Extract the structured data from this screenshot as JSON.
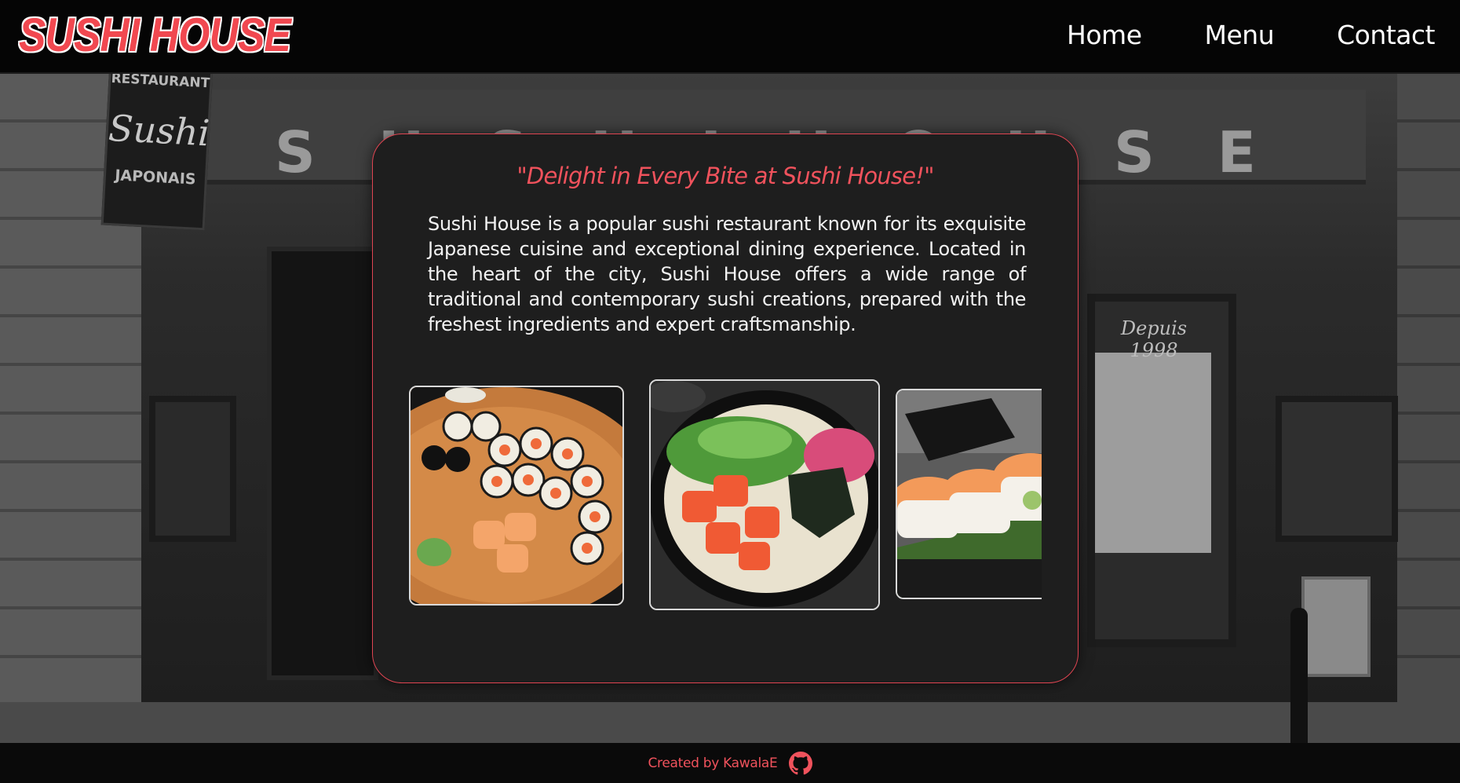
{
  "header": {
    "logo_text": "SUSHI HOUSE",
    "nav": [
      {
        "label": "Home"
      },
      {
        "label": "Menu"
      },
      {
        "label": "Contact"
      }
    ]
  },
  "background": {
    "facade_letters": [
      "S",
      "U",
      "S",
      "H",
      "I",
      "H",
      "O",
      "U",
      "S",
      "E"
    ],
    "sign_top": "RESTAURANT",
    "sign_main": "Sushi",
    "sign_bottom": "JAPONAIS",
    "window_script": "Depuis 1998"
  },
  "card": {
    "tagline": "\"Delight in Every Bite at Sushi House!\"",
    "description": "Sushi House is a popular sushi restaurant known for its exquisite Japanese cuisine and exceptional dining experience. Located in the heart of the city, Sushi House offers a wide range of traditional and contemporary sushi creations, prepared with the freshest ingredients and expert craftsmanship.",
    "gallery": [
      "sushi-rolls-platter",
      "salmon-poke-bowl",
      "salmon-maki-rolls"
    ]
  },
  "footer": {
    "credit": "Created by KawalaE",
    "icon": "github-icon"
  },
  "colors": {
    "accent": "#f0525c",
    "card_bg": "#1e1e1e",
    "header_bg": "#050505"
  }
}
